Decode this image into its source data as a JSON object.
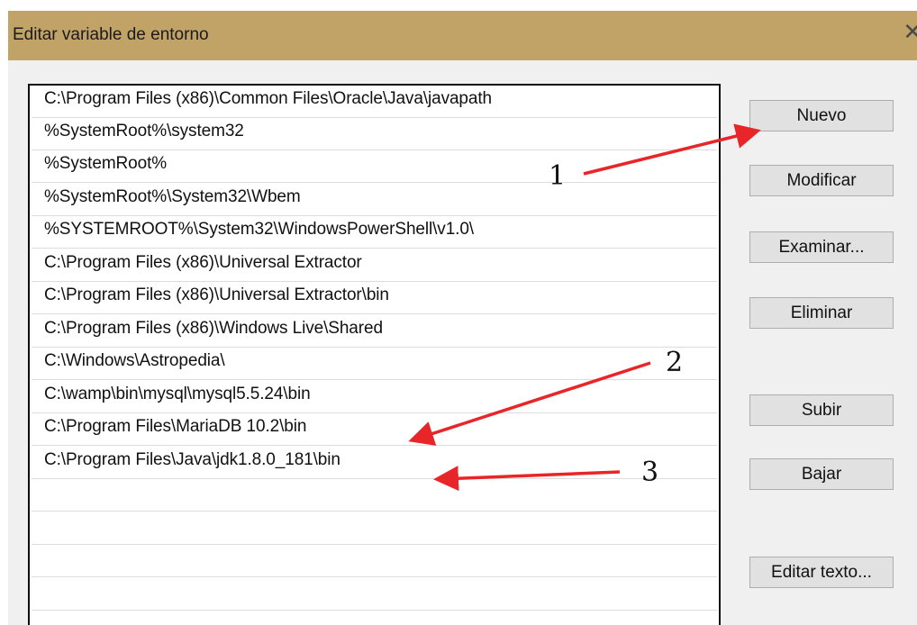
{
  "window": {
    "title": "Editar variable de entorno",
    "close_glyph": "✕"
  },
  "path_list": [
    "C:\\Program Files (x86)\\Common Files\\Oracle\\Java\\javapath",
    "%SystemRoot%\\system32",
    "%SystemRoot%",
    "%SystemRoot%\\System32\\Wbem",
    "%SYSTEMROOT%\\System32\\WindowsPowerShell\\v1.0\\",
    "C:\\Program Files (x86)\\Universal Extractor",
    "C:\\Program Files (x86)\\Universal Extractor\\bin",
    "C:\\Program Files (x86)\\Windows Live\\Shared",
    "C:\\Windows\\Astropedia\\",
    "C:\\wamp\\bin\\mysql\\mysql5.5.24\\bin",
    "C:\\Program Files\\MariaDB 10.2\\bin",
    "C:\\Program Files\\Java\\jdk1.8.0_181\\bin",
    "",
    "",
    "",
    ""
  ],
  "buttons": {
    "nuevo": "Nuevo",
    "modificar": "Modificar",
    "examinar": "Examinar...",
    "eliminar": "Eliminar",
    "subir": "Subir",
    "bajar": "Bajar",
    "editar_texto": "Editar texto..."
  },
  "annotations": {
    "one": "1",
    "two": "2",
    "three": "3",
    "arrow_color": "#e8262a"
  },
  "colors": {
    "titlebar": "#c1a267",
    "dialog_bg": "#f0f0f0",
    "button_bg": "#e1e1e1"
  }
}
